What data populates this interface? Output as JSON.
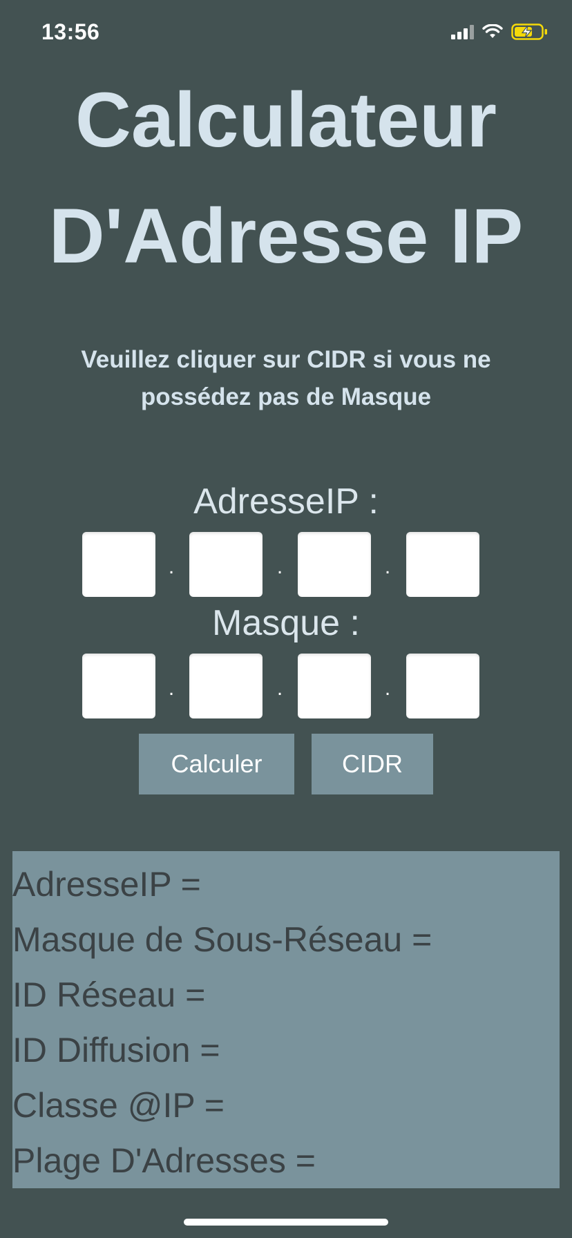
{
  "status_bar": {
    "time": "13:56"
  },
  "title": {
    "line1": "Calculateur",
    "line2": "D'Adresse IP"
  },
  "instruction": "Veuillez cliquer sur CIDR si vous ne possédez pas de Masque",
  "ip_address": {
    "label": "AdresseIP :",
    "octets": [
      "",
      "",
      "",
      ""
    ],
    "separator": "."
  },
  "mask": {
    "label": "Masque :",
    "octets": [
      "",
      "",
      "",
      ""
    ],
    "separator": "."
  },
  "buttons": {
    "calculate": "Calculer",
    "cidr": "CIDR"
  },
  "results": {
    "ip_address": "AdresseIP =",
    "subnet_mask": "Masque de Sous-Réseau =",
    "network_id": "ID Réseau =",
    "broadcast_id": "ID Diffusion =",
    "ip_class": "Classe @IP =",
    "address_range": "Plage D'Adresses ="
  },
  "icons": {
    "signal": "cellular-signal-icon",
    "wifi": "wifi-icon",
    "battery": "battery-charging-icon"
  },
  "colors": {
    "background": "#435252",
    "title_text": "#d5e3ec",
    "button_bg": "#7a939c",
    "results_bg": "#7a939c",
    "results_text": "#3b4245",
    "battery_fill": "#f5d90a"
  }
}
